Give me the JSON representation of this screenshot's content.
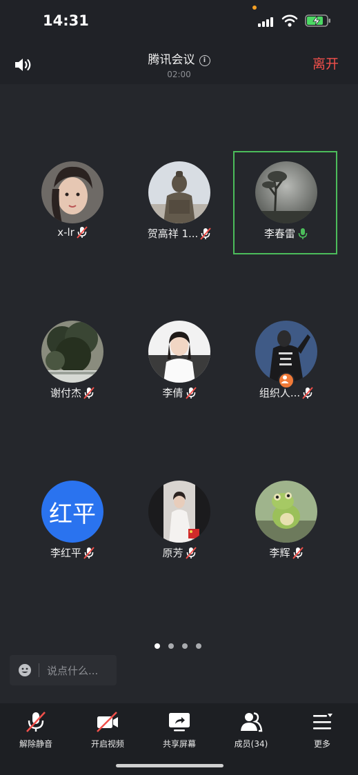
{
  "status_bar": {
    "time": "14:31"
  },
  "header": {
    "title": "腾讯会议",
    "info_symbol": "i",
    "duration": "02:00",
    "leave_label": "离开"
  },
  "participants": [
    {
      "name": "x-lr",
      "mic": "muted",
      "avatar": "photo-woman"
    },
    {
      "name": "贺高祥 1...",
      "mic": "muted",
      "avatar": "photo-terracotta-warrior"
    },
    {
      "name": "李春雷",
      "mic": "speaking",
      "avatar": "photo-misty-tree",
      "active_speaker": true
    },
    {
      "name": "谢付杰",
      "mic": "muted",
      "avatar": "photo-tree"
    },
    {
      "name": "李倩",
      "mic": "muted",
      "avatar": "photo-girl"
    },
    {
      "name": "组织人...",
      "mic": "muted",
      "avatar": "photo-jacket",
      "host": true
    },
    {
      "name": "李红平",
      "mic": "muted",
      "avatar_text": "红平",
      "avatar_color": "#2a73ef"
    },
    {
      "name": "原芳",
      "mic": "muted",
      "avatar": "photo-bride"
    },
    {
      "name": "李辉",
      "mic": "muted",
      "avatar": "photo-frog"
    }
  ],
  "pagination": {
    "pages": 4,
    "current": 1
  },
  "chat": {
    "placeholder": "说点什么..."
  },
  "toolbar": {
    "unmute_label": "解除静音",
    "video_label": "开启视频",
    "share_label": "共享屏幕",
    "members_label": "成员(34)",
    "more_label": "更多"
  },
  "colors": {
    "accent_red": "#f2504b",
    "speaking_green": "#4cbd5b",
    "avatar_blue": "#2a73ef"
  }
}
